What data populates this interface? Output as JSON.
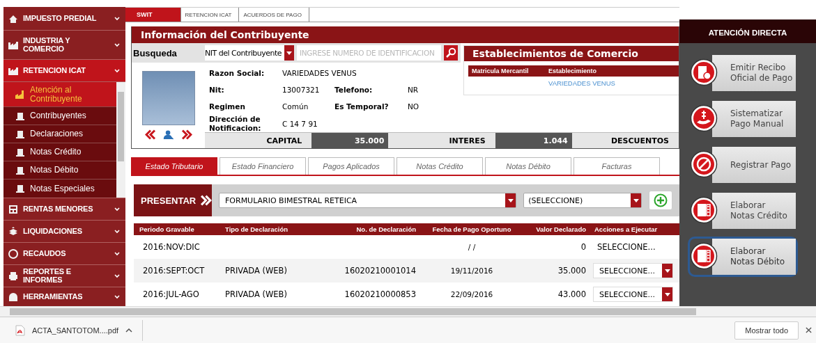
{
  "sidebar": {
    "sections": [
      {
        "label": "IMPUESTO PREDIAL",
        "expanded": false
      },
      {
        "label": "INDUSTRIA Y COMERCIO",
        "expanded": false
      },
      {
        "label": "RETENCION ICAT",
        "expanded": true,
        "children": [
          {
            "label": "Atención al Contribuyente",
            "selected": true
          },
          {
            "label": "Contribuyentes",
            "selected": false
          },
          {
            "label": "Declaraciones",
            "selected": false
          },
          {
            "label": "Notas Crédito",
            "selected": false
          },
          {
            "label": "Notas Débito",
            "selected": false
          },
          {
            "label": "Notas Especiales",
            "selected": false
          }
        ]
      },
      {
        "label": "RENTAS MENORES",
        "expanded": false
      },
      {
        "label": "LIQUIDACIONES",
        "expanded": false
      },
      {
        "label": "RECAUDOS",
        "expanded": false
      },
      {
        "label": "REPORTES E INFORMES",
        "expanded": false
      },
      {
        "label": "HERRAMIENTAS",
        "expanded": false
      }
    ]
  },
  "breadcrumb": [
    "SWIT",
    "RETENCION ICAT",
    "ACUERDOS DE PAGO"
  ],
  "contribuyente": {
    "title": "Información del Contribuyente",
    "search_label": "Busqueda",
    "search_type": "NIT del Contribuyente",
    "search_placeholder": "INGRESE NUMERO DE IDENTIFICACION",
    "fields": [
      [
        {
          "label": "Razon Social:",
          "value": "VARIEDADES VENUS"
        }
      ],
      [
        {
          "label": "Nit:",
          "value": "13007321"
        },
        {
          "label": "Telefono:",
          "value": "NR"
        }
      ],
      [
        {
          "label": "Regimen",
          "value": "Común"
        },
        {
          "label": "Es Temporal?",
          "value": "NO"
        }
      ],
      [
        {
          "label": "Dirección de Notificacion:",
          "value": "C 14 7 91"
        }
      ]
    ],
    "totals": [
      {
        "label": "CAPITAL",
        "value": "35.000"
      },
      {
        "label": "INTERES",
        "value": "1.044"
      },
      {
        "label": "DESCUENTOS"
      }
    ]
  },
  "establecimientos": {
    "title": "Establecimientos de Comercio",
    "columns": [
      "Matricula Mercantil",
      "Establecimiento"
    ],
    "rows": [
      [
        "",
        "VARIEDADES VENUS"
      ]
    ]
  },
  "tabs": [
    {
      "label": "Estado Tributario",
      "selected": true
    },
    {
      "label": "Estado Financiero",
      "selected": false
    },
    {
      "label": "Pagos Aplicados",
      "selected": false
    },
    {
      "label": "Notas Crédito",
      "selected": false
    },
    {
      "label": "Notas Débito",
      "selected": false
    },
    {
      "label": "Facturas",
      "selected": false
    }
  ],
  "presentar": {
    "label": "PRESENTAR",
    "form": "FORMULARIO BIMESTRAL RETEICA",
    "period": "(SELECCIONE)"
  },
  "table": {
    "columns": [
      "Periodo Gravable",
      "Tipo de Declaración",
      "No. de Declaración",
      "Fecha de Pago Oportuno",
      "Valor Declarado",
      "Acciones a Ejecutar"
    ],
    "rows": [
      {
        "cells": [
          "2016:NOV:DIC",
          "",
          "",
          "/ /",
          "0"
        ],
        "action": "SELECCIONE...",
        "kind": "text"
      },
      {
        "cells": [
          "2016:SEPT:OCT",
          "PRIVADA (WEB)",
          "16020210001014",
          "19/11/2016",
          "35.000"
        ],
        "action": "SELECCIONE...",
        "kind": "select"
      },
      {
        "cells": [
          "2016:JUL-AGO",
          "PRIVADA (WEB)",
          "16020210000853",
          "22/09/2016",
          "43.000"
        ],
        "action": "SELECCIONE...",
        "kind": "select"
      }
    ]
  },
  "atencion": {
    "title": "ATENCIÓN DIRECTA",
    "actions": [
      {
        "lines": [
          "Emitir Recibo",
          "Oficial de Pago"
        ],
        "selected": false
      },
      {
        "lines": [
          "Sistematizar",
          "Pago Manual"
        ],
        "selected": false
      },
      {
        "lines": [
          "Registrar Pago"
        ],
        "selected": false
      },
      {
        "lines": [
          "Elaborar",
          "Notas Crédito"
        ],
        "selected": false
      },
      {
        "lines": [
          "Elaborar",
          "Notas Débito"
        ],
        "selected": true
      }
    ]
  },
  "downloads": {
    "file": "ACTA_SANTOTOM....pdf",
    "show_all": "Mostrar todo"
  }
}
